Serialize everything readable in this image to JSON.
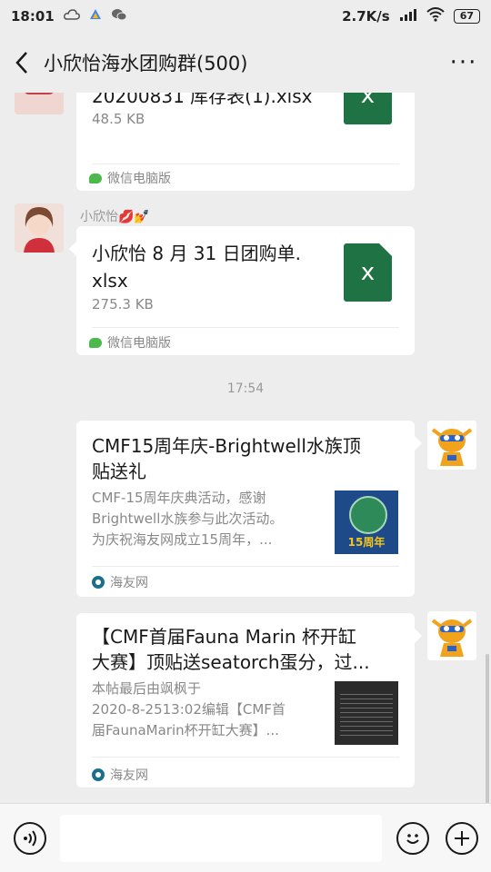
{
  "status_bar": {
    "time": "18:01",
    "network_speed": "2.7K/s",
    "battery": "67",
    "left_icons": [
      "cloud-icon",
      "drive-icon",
      "wechat-icon"
    ],
    "right_icons": [
      "signal-icon",
      "wifi-icon",
      "battery-icon"
    ]
  },
  "nav": {
    "title": "小欣怡海水团购群(500)",
    "back_icon": "chevron-left-icon",
    "more_label": "···"
  },
  "messages": {
    "file1": {
      "name": "20200831 库存表(1).xlsx",
      "size": "48.5 KB",
      "source": "微信电脑版",
      "file_icon_label": "x"
    },
    "file2": {
      "sender": "小欣怡💋💅",
      "name_line1": "小欣怡 8 月 31 日团购单.",
      "name_line2": "xlsx",
      "size": "275.3 KB",
      "source": "微信电脑版",
      "file_icon_label": "x"
    },
    "timestamp": "17:54",
    "link1": {
      "title_line1": "CMF15周年庆-Brightwell水族顶",
      "title_line2": "贴送礼",
      "desc_line1": "CMF-15周年庆典活动，感谢",
      "desc_line2": "Brightwell水族参与此次活动。",
      "desc_line3": "为庆祝海友网成立15周年，...",
      "thumb_text": "15周年",
      "source": "海友网"
    },
    "link2": {
      "title_line1": "【CMF首届Fauna Marin 杯开缸",
      "title_line2": "大赛】顶贴送seatorch蛋分，过...",
      "desc_line1": "本帖最后由飒枫于",
      "desc_line2": "2020-8-2513:02编辑【CMF首",
      "desc_line3": "届FaunaMarin杯开缸大赛】...",
      "source": "海友网"
    }
  },
  "input_bar": {
    "voice_icon": "voice-icon",
    "emoji_icon": "emoji-icon",
    "plus_icon": "plus-icon"
  },
  "colors": {
    "background": "#ededed",
    "excel_green": "#1f7244",
    "wechat_green": "#4cb94c"
  }
}
